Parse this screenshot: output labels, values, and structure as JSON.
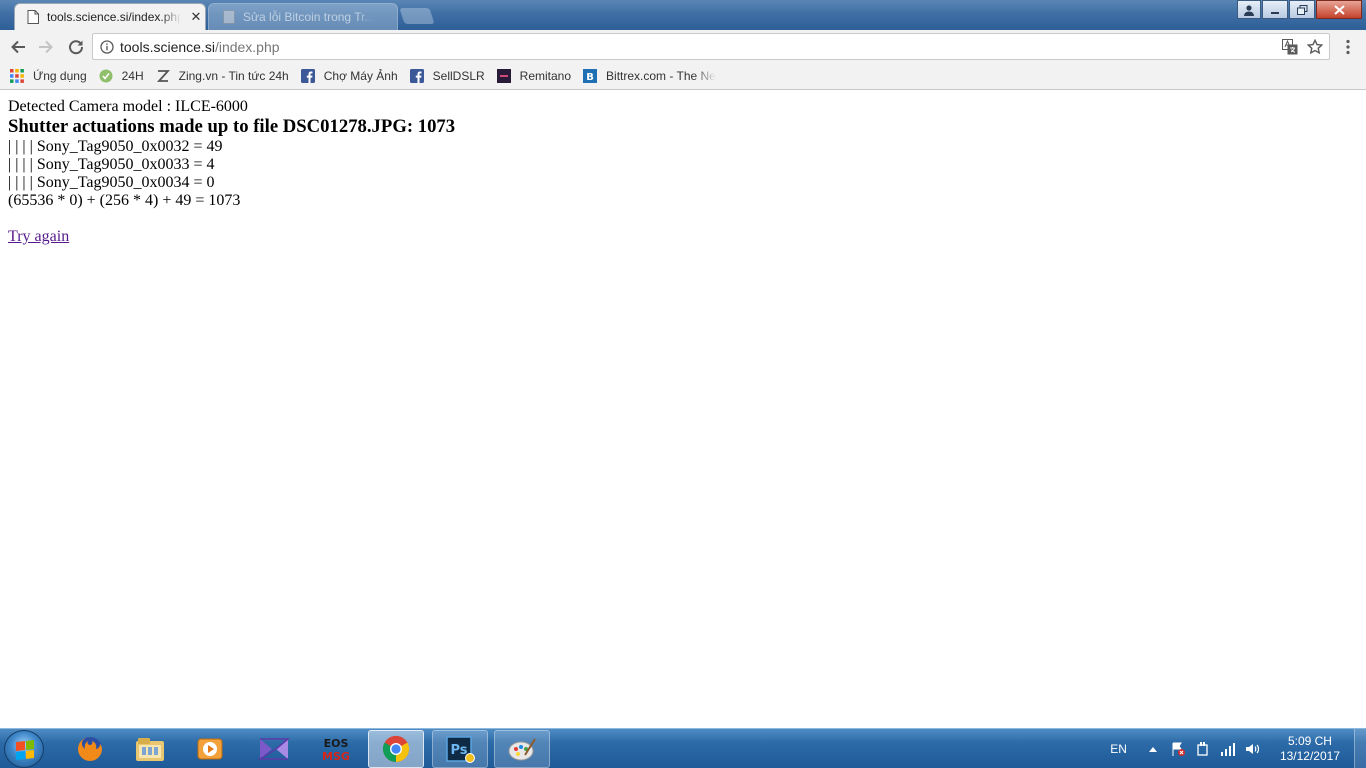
{
  "browser": {
    "active_tab": {
      "title": "tools.science.si/index.php",
      "close_symbol": "✕"
    },
    "inactive_tab": {
      "title": "Sửa lỗi Bitcoin trong Tr..."
    },
    "address": {
      "host": "tools.science.si",
      "path": "/index.php"
    },
    "bookmarks": [
      {
        "label": "Ứng dụng",
        "icon": "apps-grid-icon"
      },
      {
        "label": "24H",
        "icon": "24h-icon"
      },
      {
        "label": "Zing.vn - Tin tức 24h",
        "icon": "zing-icon"
      },
      {
        "label": "Chợ Máy Ảnh",
        "icon": "facebook-icon"
      },
      {
        "label": "SellDSLR",
        "icon": "facebook-icon"
      },
      {
        "label": "Remitano",
        "icon": "remitano-icon"
      },
      {
        "label": "Bittrex.com - The Ne",
        "icon": "bittrex-icon"
      }
    ]
  },
  "page": {
    "camera_line": "Detected Camera model : ILCE-6000",
    "heading": "Shutter actuations made up to file DSC01278.JPG: 1073",
    "tags": [
      "| | | | Sony_Tag9050_0x0032 = 49",
      "| | | | Sony_Tag9050_0x0033 = 4",
      "| | | | Sony_Tag9050_0x0034 = 0"
    ],
    "formula": "(65536 * 0) + (256 * 4) + 49 = 1073",
    "link": "Try again"
  },
  "taskbar": {
    "apps": [
      "firefox-icon",
      "file-explorer-icon",
      "media-player-icon",
      "visual-studio-icon",
      "eos-msg-icon",
      "chrome-icon",
      "photoshop-icon",
      "paint-icon"
    ],
    "eos_label_top": "EOS",
    "eos_label_bottom": "MSG",
    "ps_label": "Ps",
    "language": "EN",
    "time": "5:09 CH",
    "date": "13/12/2017"
  },
  "colors": {
    "link_visited": "#551a8b",
    "taskbar_blue": "#2c6aa8",
    "chrome_frame": "#3f6fa5"
  }
}
